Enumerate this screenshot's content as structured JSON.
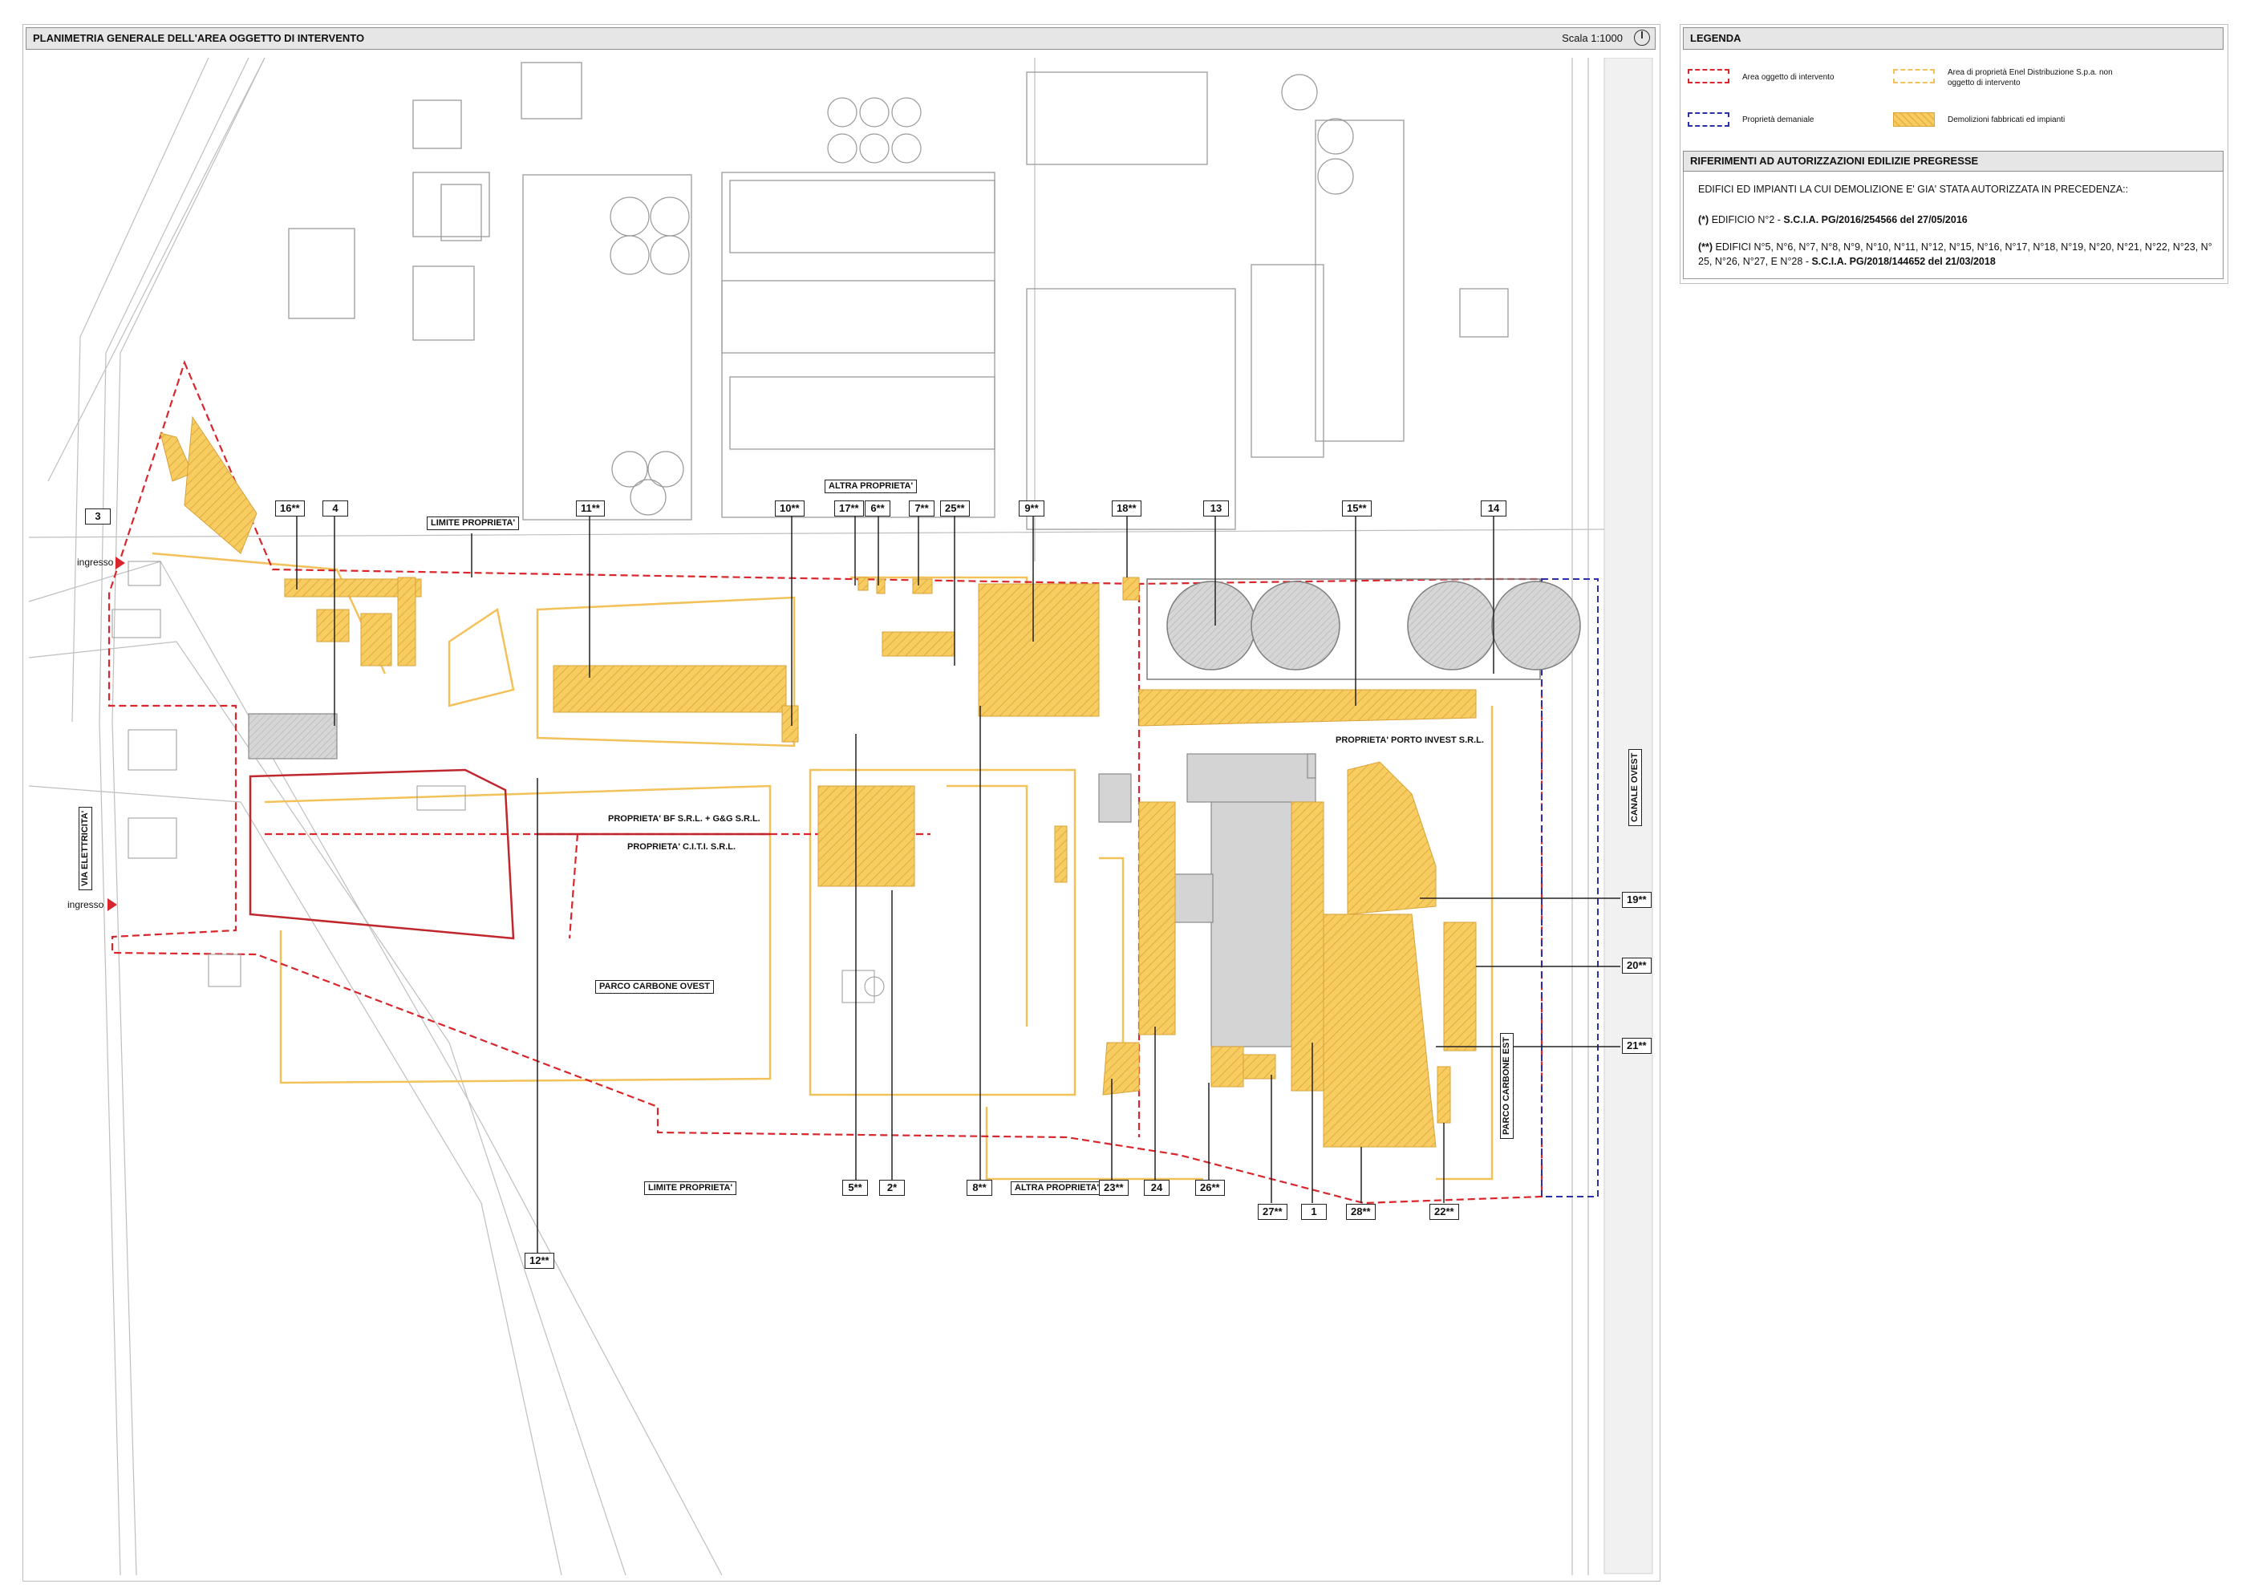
{
  "header": {
    "title": "PLANIMETRIA GENERALE DELL'AREA OGGETTO DI INTERVENTO",
    "scale": "Scala 1:1000"
  },
  "legend": {
    "title": "LEGENDA",
    "items": [
      {
        "label": "Area oggetto di intervento",
        "color": "#d9262c"
      },
      {
        "label": "Area di proprietà Enel Distribuzione S.p.a. non oggetto di intervento",
        "color": "#f3c15a"
      },
      {
        "label": "Proprietà demaniale",
        "color": "#2b2fa8"
      },
      {
        "label": "Demolizioni fabbricati ed impianti",
        "color": "#f7cc60"
      }
    ]
  },
  "references": {
    "title": "RIFERIMENTI AD AUTORIZZAZIONI EDILIZIE PREGRESSE",
    "intro": "EDIFICI ED IMPIANTI LA CUI DEMOLIZIONE E' GIA' STATA AUTORIZZATA IN PRECEDENZA::",
    "ref1_marker": "(*)",
    "ref1_text": "EDIFICIO N°2 - ",
    "ref1_auth": "S.C.I.A. PG/2016/254566 del 27/05/2016",
    "ref2_marker": "(**)",
    "ref2_text_line1": "EDIFICI N°5, N°6, N°7, N°8, N°9, N°10, N°11, N°12, N°15, N°16, N°17, N°18, N°19, N°20, N°21, N°22, N°23, N°",
    "ref2_text_line2": "25, N°26, N°27, E N°28  - ",
    "ref2_auth": "S.C.I.A. PG/2018/144652 del 21/03/2018"
  },
  "plan_labels": {
    "limite_proprieta": "LIMITE PROPRIETA'",
    "altra_proprieta": "ALTRA PROPRIETA'",
    "ingresso": "ingresso",
    "via_elettricita": "VIA ELETTRICITA'",
    "bf_srl": "PROPRIETA' BF S.R.L. + G&G S.R.L.",
    "citi_srl": "PROPRIETA' C.I.T.I. S.R.L.",
    "parco_ovest": "PARCO CARBONE OVEST",
    "parco_est": "PARCO CARBONE EST",
    "porto_invest": "PROPRIETA' PORTO INVEST S.R.L.",
    "canale_ovest": "CANALE  OVEST"
  },
  "buildings": {
    "b3": "3",
    "b16": "16**",
    "b4": "4",
    "b11": "11**",
    "b10": "10**",
    "b17": "17**",
    "b6": "6**",
    "b7": "7**",
    "b25": "25**",
    "b9": "9**",
    "b18": "18**",
    "b13": "13",
    "b15": "15**",
    "b14": "14",
    "b19": "19**",
    "b20": "20**",
    "b21": "21**",
    "b5": "5**",
    "b2": "2*",
    "b8": "8**",
    "b23": "23**",
    "b24": "24",
    "b26": "26**",
    "b27": "27**",
    "b1": "1",
    "b28": "28**",
    "b22": "22**",
    "b12": "12**"
  }
}
